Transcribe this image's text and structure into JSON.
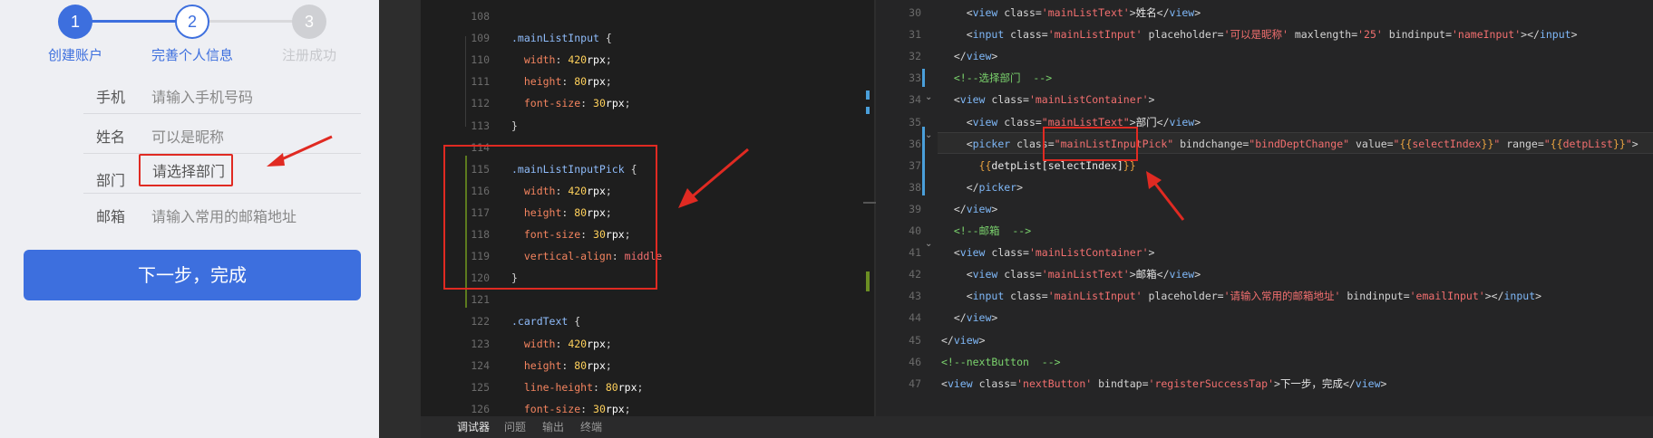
{
  "steps": [
    {
      "num": "1",
      "label": "创建账户",
      "state": "done"
    },
    {
      "num": "2",
      "label": "完善个人信息",
      "state": "current"
    },
    {
      "num": "3",
      "label": "注册成功",
      "state": "todo"
    }
  ],
  "form": {
    "rows": [
      {
        "label": "手机",
        "value": "请输入手机号码"
      },
      {
        "label": "姓名",
        "value": "可以是昵称"
      },
      {
        "label": "部门",
        "value": "请选择部门"
      },
      {
        "label": "邮箱",
        "value": "请输入常用的邮箱地址"
      }
    ],
    "next_button": "下一步，完成"
  },
  "css_editor": {
    "lines": [
      {
        "n": "108",
        "tokens": []
      },
      {
        "n": "109",
        "tokens": [
          [
            "sel",
            ".mainListInput "
          ],
          [
            "pun",
            "{"
          ]
        ]
      },
      {
        "n": "110",
        "tokens": [
          [
            "prop",
            "  width"
          ],
          [
            "pun",
            ": "
          ],
          [
            "num",
            "420"
          ],
          [
            "unit",
            "rpx"
          ],
          [
            "pun",
            ";"
          ]
        ]
      },
      {
        "n": "111",
        "tokens": [
          [
            "prop",
            "  height"
          ],
          [
            "pun",
            ": "
          ],
          [
            "num",
            "80"
          ],
          [
            "unit",
            "rpx"
          ],
          [
            "pun",
            ";"
          ]
        ]
      },
      {
        "n": "112",
        "tokens": [
          [
            "prop",
            "  font-size"
          ],
          [
            "pun",
            ": "
          ],
          [
            "num",
            "30"
          ],
          [
            "unit",
            "rpx"
          ],
          [
            "pun",
            ";"
          ]
        ]
      },
      {
        "n": "113",
        "tokens": [
          [
            "pun",
            "}"
          ]
        ]
      },
      {
        "n": "114",
        "tokens": []
      },
      {
        "n": "115",
        "tokens": [
          [
            "sel",
            ".mainListInputPick "
          ],
          [
            "pun",
            "{"
          ]
        ]
      },
      {
        "n": "116",
        "tokens": [
          [
            "prop",
            "  width"
          ],
          [
            "pun",
            ": "
          ],
          [
            "num",
            "420"
          ],
          [
            "unit",
            "rpx"
          ],
          [
            "pun",
            ";"
          ]
        ]
      },
      {
        "n": "117",
        "tokens": [
          [
            "prop",
            "  height"
          ],
          [
            "pun",
            ": "
          ],
          [
            "num",
            "80"
          ],
          [
            "unit",
            "rpx"
          ],
          [
            "pun",
            ";"
          ]
        ]
      },
      {
        "n": "118",
        "tokens": [
          [
            "prop",
            "  font-size"
          ],
          [
            "pun",
            ": "
          ],
          [
            "num",
            "30"
          ],
          [
            "unit",
            "rpx"
          ],
          [
            "pun",
            ";"
          ]
        ]
      },
      {
        "n": "119",
        "tokens": [
          [
            "prop",
            "  vertical-align"
          ],
          [
            "pun",
            ": "
          ],
          [
            "str",
            "middle"
          ]
        ]
      },
      {
        "n": "120",
        "tokens": [
          [
            "pun",
            "}"
          ]
        ]
      },
      {
        "n": "121",
        "tokens": []
      },
      {
        "n": "122",
        "tokens": [
          [
            "sel",
            ".cardText "
          ],
          [
            "pun",
            "{"
          ]
        ]
      },
      {
        "n": "123",
        "tokens": [
          [
            "prop",
            "  width"
          ],
          [
            "pun",
            ": "
          ],
          [
            "num",
            "420"
          ],
          [
            "unit",
            "rpx"
          ],
          [
            "pun",
            ";"
          ]
        ]
      },
      {
        "n": "124",
        "tokens": [
          [
            "prop",
            "  height"
          ],
          [
            "pun",
            ": "
          ],
          [
            "num",
            "80"
          ],
          [
            "unit",
            "rpx"
          ],
          [
            "pun",
            ";"
          ]
        ]
      },
      {
        "n": "125",
        "tokens": [
          [
            "prop",
            "  line-height"
          ],
          [
            "pun",
            ": "
          ],
          [
            "num",
            "80"
          ],
          [
            "unit",
            "rpx"
          ],
          [
            "pun",
            ";"
          ]
        ]
      },
      {
        "n": "126",
        "tokens": [
          [
            "prop",
            "  font-size"
          ],
          [
            "pun",
            ": "
          ],
          [
            "num",
            "30"
          ],
          [
            "unit",
            "rpx"
          ],
          [
            "pun",
            ";"
          ]
        ]
      }
    ]
  },
  "wxml_editor": {
    "lines": [
      {
        "n": "30",
        "tokens": [
          [
            "pun",
            "    <"
          ],
          [
            "tag",
            "view "
          ],
          [
            "attr",
            "class="
          ],
          [
            "str",
            "'mainListText'"
          ],
          [
            "pun",
            ">"
          ],
          [
            "txt",
            "姓名"
          ],
          [
            "pun",
            "</"
          ],
          [
            "tag",
            "view"
          ],
          [
            "pun",
            ">"
          ]
        ]
      },
      {
        "n": "31",
        "tokens": [
          [
            "pun",
            "    <"
          ],
          [
            "tag",
            "input "
          ],
          [
            "attr",
            "class="
          ],
          [
            "str",
            "'mainListInput'"
          ],
          [
            "attr",
            " placeholder="
          ],
          [
            "strCn",
            "'可以是昵称'"
          ],
          [
            "attr",
            " maxlength="
          ],
          [
            "str",
            "'25'"
          ],
          [
            "attr",
            " bindinput="
          ],
          [
            "str",
            "'nameInput'"
          ],
          [
            "pun",
            "></"
          ],
          [
            "tag",
            "input"
          ],
          [
            "pun",
            ">"
          ]
        ]
      },
      {
        "n": "32",
        "tokens": [
          [
            "pun",
            "  </"
          ],
          [
            "tag",
            "view"
          ],
          [
            "pun",
            ">"
          ]
        ]
      },
      {
        "n": "33",
        "tokens": [
          [
            "cmt",
            "  <!--选择部门  -->"
          ]
        ]
      },
      {
        "n": "34",
        "tokens": [
          [
            "pun",
            "  <"
          ],
          [
            "tag",
            "view "
          ],
          [
            "attr",
            "class="
          ],
          [
            "str",
            "'mainListContainer'"
          ],
          [
            "pun",
            ">"
          ]
        ]
      },
      {
        "n": "35",
        "tokens": [
          [
            "pun",
            "    <"
          ],
          [
            "tag",
            "view "
          ],
          [
            "attr",
            "class="
          ],
          [
            "str",
            "\"mainListText\""
          ],
          [
            "pun",
            ">"
          ],
          [
            "txt",
            "部门"
          ],
          [
            "pun",
            "</"
          ],
          [
            "tag",
            "view"
          ],
          [
            "pun",
            ">"
          ]
        ]
      },
      {
        "n": "36",
        "tokens": [
          [
            "pun",
            "    <"
          ],
          [
            "tag",
            "picker "
          ],
          [
            "attr",
            "class="
          ],
          [
            "str",
            "\"mainListInputPick\""
          ],
          [
            "attr",
            " bindchange="
          ],
          [
            "str",
            "\"bindDeptChange\""
          ],
          [
            "attr",
            " value="
          ],
          [
            "str",
            "\""
          ],
          [
            "mus",
            "{{"
          ],
          [
            "str",
            "selectIndex"
          ],
          [
            "mus",
            "}}"
          ],
          [
            "str",
            "\""
          ],
          [
            "attr",
            " range="
          ],
          [
            "str",
            "\""
          ],
          [
            "mus",
            "{{"
          ],
          [
            "str",
            "detpList"
          ],
          [
            "mus",
            "}}"
          ],
          [
            "str",
            "\""
          ],
          [
            "pun",
            ">"
          ]
        ]
      },
      {
        "n": "37",
        "tokens": [
          [
            "mus",
            "      {{"
          ],
          [
            "txt",
            "detpList[selectIndex]"
          ],
          [
            "mus",
            "}}"
          ]
        ]
      },
      {
        "n": "38",
        "tokens": [
          [
            "pun",
            "    </"
          ],
          [
            "tag",
            "picker"
          ],
          [
            "pun",
            ">"
          ]
        ]
      },
      {
        "n": "39",
        "tokens": [
          [
            "pun",
            "  </"
          ],
          [
            "tag",
            "view"
          ],
          [
            "pun",
            ">"
          ]
        ]
      },
      {
        "n": "40",
        "tokens": [
          [
            "cmt",
            "  <!--邮箱  -->"
          ]
        ]
      },
      {
        "n": "41",
        "tokens": [
          [
            "pun",
            "  <"
          ],
          [
            "tag",
            "view "
          ],
          [
            "attr",
            "class="
          ],
          [
            "str",
            "'mainListContainer'"
          ],
          [
            "pun",
            ">"
          ]
        ]
      },
      {
        "n": "42",
        "tokens": [
          [
            "pun",
            "    <"
          ],
          [
            "tag",
            "view "
          ],
          [
            "attr",
            "class="
          ],
          [
            "str",
            "'mainListText'"
          ],
          [
            "pun",
            ">"
          ],
          [
            "txt",
            "邮箱"
          ],
          [
            "pun",
            "</"
          ],
          [
            "tag",
            "view"
          ],
          [
            "pun",
            ">"
          ]
        ]
      },
      {
        "n": "43",
        "tokens": [
          [
            "pun",
            "    <"
          ],
          [
            "tag",
            "input "
          ],
          [
            "attr",
            "class="
          ],
          [
            "str",
            "'mainListInput'"
          ],
          [
            "attr",
            " placeholder="
          ],
          [
            "strCn",
            "'请输入常用的邮箱地址'"
          ],
          [
            "attr",
            " bindinput="
          ],
          [
            "str",
            "'emailInput'"
          ],
          [
            "pun",
            "></"
          ],
          [
            "tag",
            "input"
          ],
          [
            "pun",
            ">"
          ]
        ]
      },
      {
        "n": "44",
        "tokens": [
          [
            "pun",
            "  </"
          ],
          [
            "tag",
            "view"
          ],
          [
            "pun",
            ">"
          ]
        ]
      },
      {
        "n": "45",
        "tokens": [
          [
            "pun",
            "</"
          ],
          [
            "tag",
            "view"
          ],
          [
            "pun",
            ">"
          ]
        ]
      },
      {
        "n": "46",
        "tokens": [
          [
            "cmt",
            "<!--nextButton  -->"
          ]
        ]
      },
      {
        "n": "47",
        "tokens": [
          [
            "pun",
            "<"
          ],
          [
            "tag",
            "view "
          ],
          [
            "attr",
            "class="
          ],
          [
            "str",
            "'nextButton'"
          ],
          [
            "attr",
            " bindtap="
          ],
          [
            "str",
            "'registerSuccessTap'"
          ],
          [
            "pun",
            ">"
          ],
          [
            "txt",
            "下一步，完成"
          ],
          [
            "pun",
            "</"
          ],
          [
            "tag",
            "view"
          ],
          [
            "pun",
            ">"
          ]
        ]
      }
    ]
  },
  "bottom_tabs": [
    "调试器",
    "问题",
    "输出",
    "终端"
  ],
  "colors": {
    "accent": "#3d6fde",
    "annotation_red": "#e02a22"
  }
}
